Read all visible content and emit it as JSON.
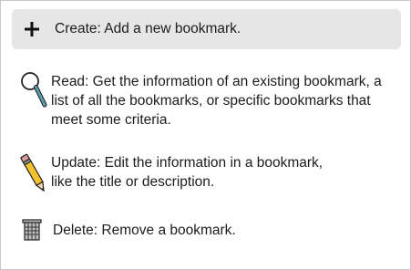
{
  "operations": [
    {
      "key": "create",
      "icon": "plus-icon",
      "text": "Create: Add a new bookmark."
    },
    {
      "key": "read",
      "icon": "magnifier-icon",
      "text": "Read: Get the information of an existing bookmark, a list of all the bookmarks, or specific bookmarks that meet some criteria."
    },
    {
      "key": "update",
      "icon": "pencil-icon",
      "text": "Update: Edit the information in a bookmark, like the title or description."
    },
    {
      "key": "delete",
      "icon": "trash-can-icon",
      "text": "Delete: Remove a bookmark."
    }
  ],
  "colors": {
    "highlight_bg": "#e6e6e6",
    "border": "#c8c8c8",
    "pencil_yellow": "#f2c12e",
    "magnifier_handle": "#5b9aa9"
  }
}
